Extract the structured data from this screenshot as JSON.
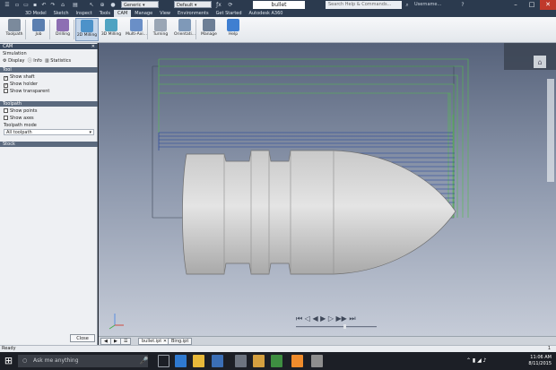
{
  "titlebar": {
    "workspace": "Generic",
    "appearance": "Default",
    "doc_title": "bullet",
    "search_placeholder": "Search Help & Commands...",
    "user": "Username..."
  },
  "menu": [
    "3D Model",
    "Sketch",
    "Inspect",
    "Tools",
    "CAM",
    "Manage",
    "View",
    "Environments",
    "Get Started",
    "Autodesk A360"
  ],
  "menu_active": "CAM",
  "ribbon": [
    {
      "label": "Toolpath",
      "icon": "toolpath-icon"
    },
    {
      "label": "Job",
      "icon": "job-icon"
    },
    {
      "label": "Drilling",
      "icon": "drilling-icon"
    },
    {
      "label": "2D Milling",
      "icon": "2d-milling-icon"
    },
    {
      "label": "3D Milling",
      "icon": "3d-milling-icon"
    },
    {
      "label": "Multi-Axi...",
      "icon": "multi-axis-icon"
    },
    {
      "label": "Turning",
      "icon": "turning-icon"
    },
    {
      "label": "Orientati...",
      "icon": "orientation-icon"
    },
    {
      "label": "Manage",
      "icon": "manage-icon"
    },
    {
      "label": "Help",
      "icon": "help-icon"
    }
  ],
  "panel": {
    "header": "CAM",
    "section": "Simulation",
    "tabs": [
      "Display",
      "Info",
      "Statistics"
    ],
    "tool_section": "Tool",
    "tool_options": [
      {
        "label": "Show shaft",
        "checked": true
      },
      {
        "label": "Show holder",
        "checked": true
      },
      {
        "label": "Show transparent",
        "checked": false
      }
    ],
    "toolpath_section": "Toolpath",
    "toolpath_options": [
      {
        "label": "Show points",
        "checked": false
      },
      {
        "label": "Show axes",
        "checked": false
      }
    ],
    "toolpath_mode_label": "Toolpath mode",
    "toolpath_mode_value": "All toolpath",
    "stock_section": "Stock",
    "close_button": "Close"
  },
  "document_tabs": [
    "bullet.ipt",
    "Bing.ipt"
  ],
  "status": "Ready",
  "status_page": "1",
  "taskbar": {
    "search_placeholder": "Ask me anything",
    "time": "11:06 AM",
    "date": "8/11/2015"
  },
  "colors": {
    "title_bg": "#2b3a4e",
    "accent": "#3c4b60",
    "toolpath_green": "#53c04a",
    "toolpath_blue": "#1d3f9a",
    "part_gray": "#d8d8d8"
  }
}
